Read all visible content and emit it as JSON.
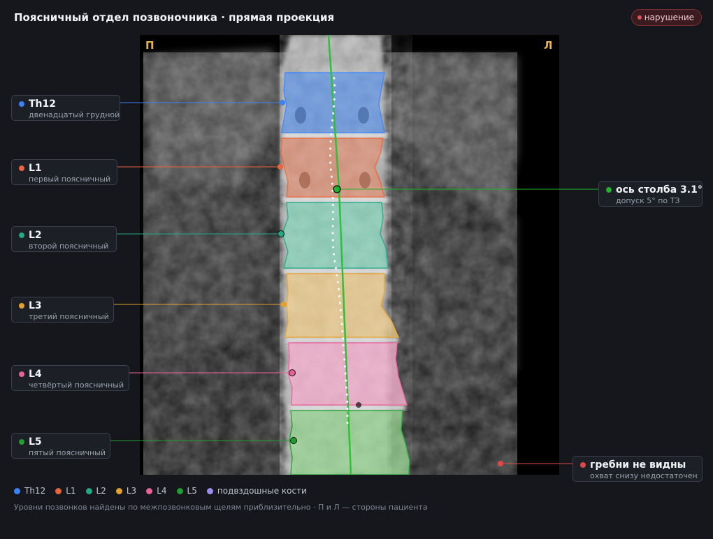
{
  "header": {
    "title": "Поясничный отдел позвоночника · прямая проекция",
    "badge": "нарушение",
    "badge_color": "#e0525a"
  },
  "image": {
    "side_right": "П",
    "side_left": "Л",
    "axis_color": "#2fbf3a"
  },
  "vertebrae": [
    {
      "id": "th12",
      "name": "Th12",
      "desc": "двенадцатый грудной",
      "color": "#3b82f6"
    },
    {
      "id": "l1",
      "name": "L1",
      "desc": "первый поясничный",
      "color": "#e8643a"
    },
    {
      "id": "l2",
      "name": "L2",
      "desc": "второй поясничный",
      "color": "#22a884"
    },
    {
      "id": "l3",
      "name": "L3",
      "desc": "третий поясничный",
      "color": "#e3a12f"
    },
    {
      "id": "l4",
      "name": "L4",
      "desc": "четвёртый поясничный",
      "color": "#e8629a"
    },
    {
      "id": "l5",
      "name": "L5",
      "desc": "пятый поясничный",
      "color": "#1f9e2f"
    }
  ],
  "annotations": {
    "axis": {
      "name": "ось столба 3.1°",
      "desc": "допуск 5° по ТЗ",
      "color": "#22b02e"
    },
    "crests": {
      "name": "гребни не видны",
      "desc": "охват снизу недостаточен",
      "color": "#e04848"
    }
  },
  "legend": [
    {
      "label": "Th12",
      "color": "#3b82f6"
    },
    {
      "label": "L1",
      "color": "#e8643a"
    },
    {
      "label": "L2",
      "color": "#22a884"
    },
    {
      "label": "L3",
      "color": "#e3a12f"
    },
    {
      "label": "L4",
      "color": "#e8629a"
    },
    {
      "label": "L5",
      "color": "#1f9e2f"
    },
    {
      "label": "подвздошные кости",
      "color": "#9b8cf0"
    }
  ],
  "footnote": "Уровни позвонков найдены по межпозвонковым щелям приблизительно · П и Л — стороны пациента"
}
